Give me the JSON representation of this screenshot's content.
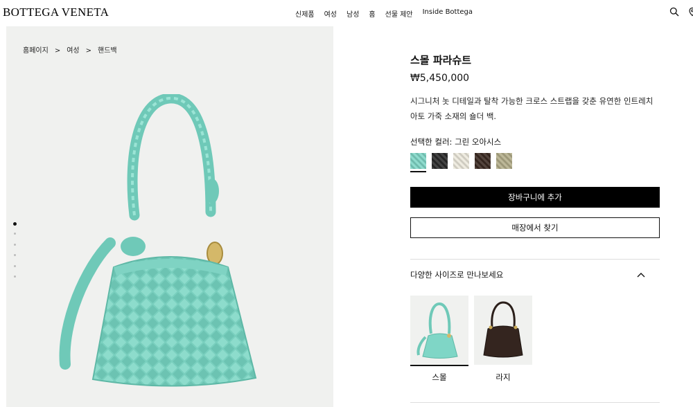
{
  "header": {
    "brand": "BOTTEGA VENETA",
    "nav": [
      "신제품",
      "여성",
      "남성",
      "홈",
      "선물 제안",
      "Inside Bottega"
    ],
    "icons": [
      "search-icon",
      "location-icon"
    ]
  },
  "breadcrumb": [
    "홈페이지",
    "여성",
    "핸드백"
  ],
  "breadcrumb_sep": ">",
  "gallery": {
    "slide_count": 6,
    "active_slide": 1
  },
  "product": {
    "name": "스몰 파라슈트",
    "price": "₩5,450,000",
    "description": "시그니처 놋 디테일과 탈착 가능한 크로스 스트랩을 갖춘 유연한 인트레치아토 가죽 소재의 숄더 백.",
    "color_label": "선택한 컬러: 그린 오아시스",
    "swatches": [
      {
        "name": "green-oasis",
        "color": "#7fd6c6",
        "selected": true
      },
      {
        "name": "black",
        "color": "#2a2a2a",
        "selected": false
      },
      {
        "name": "cream",
        "color": "#ece8dc",
        "selected": false
      },
      {
        "name": "dark-brown",
        "color": "#3b2a22",
        "selected": false
      },
      {
        "name": "olive-taupe",
        "color": "#b3ad8a",
        "selected": false
      }
    ],
    "add_to_cart": "장바구니에 추가",
    "find_in_store": "매장에서 찾기",
    "sizes_heading": "다양한 사이즈로 만나보세요",
    "sizes": [
      {
        "label": "스몰",
        "selected": true
      },
      {
        "label": "라지",
        "selected": false
      }
    ]
  }
}
